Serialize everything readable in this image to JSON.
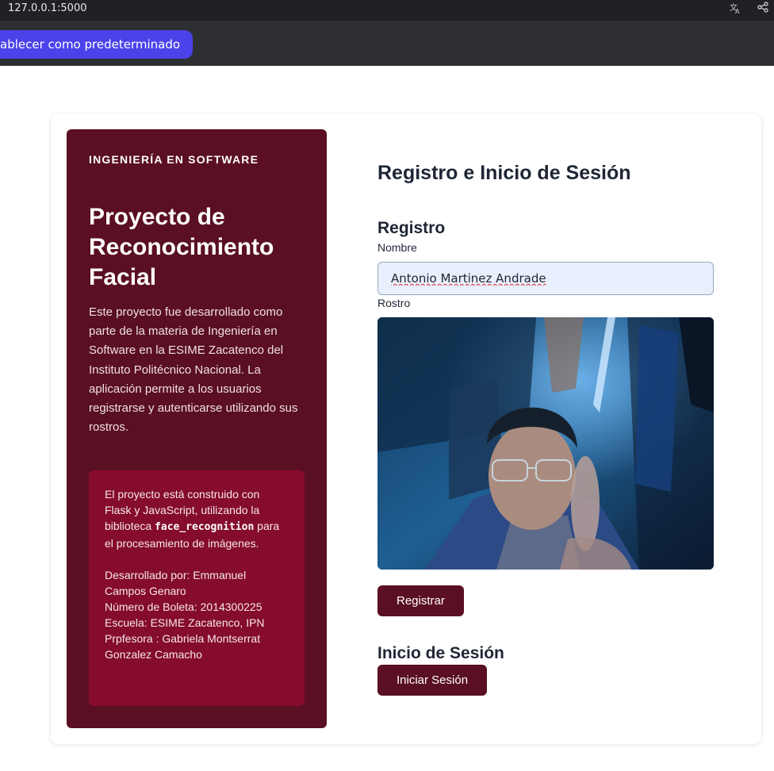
{
  "browser": {
    "url": "127.0.0.1:5000",
    "translate_icon": "translate-icon",
    "share_icon": "share-icon",
    "infobar_button_label": "ablecer como predeterminado"
  },
  "sidebar": {
    "kicker": "INGENIERÍA EN SOFTWARE",
    "title": "Proyecto de Reconocimiento Facial",
    "description": "Este proyecto fue desarrollado como parte de la materia de Ingeniería en Software en la ESIME Zacatenco del Instituto Politécnico Nacional. La aplicación permite a los usuarios registrarse y autenticarse utilizando sus rostros.",
    "info_prefix": "El proyecto está construido con Flask y JavaScript, utilizando la biblioteca",
    "info_code": "face_recognition",
    "info_suffix": "para el procesamiento de imágenes.",
    "credits": [
      "Desarrollado por: Emmanuel Campos Genaro",
      "Número de Boleta: 2014300225",
      "Escuela: ESIME Zacatenco, IPN",
      "Prpfesora : Gabriela Montserrat Gonzalez Camacho"
    ]
  },
  "main": {
    "page_title": "Registro e Inicio de Sesión",
    "register": {
      "heading": "Registro",
      "name_label": "Nombre",
      "name_value": "Antonio Martinez Andrade",
      "face_label": "Rostro",
      "submit_label": "Registrar"
    },
    "login": {
      "heading": "Inicio de Sesión",
      "submit_label": "Iniciar Sesión"
    }
  },
  "colors": {
    "brand_dark": "#5a0f23",
    "brand_box": "#850c2c",
    "accent": "#4c42ea"
  }
}
